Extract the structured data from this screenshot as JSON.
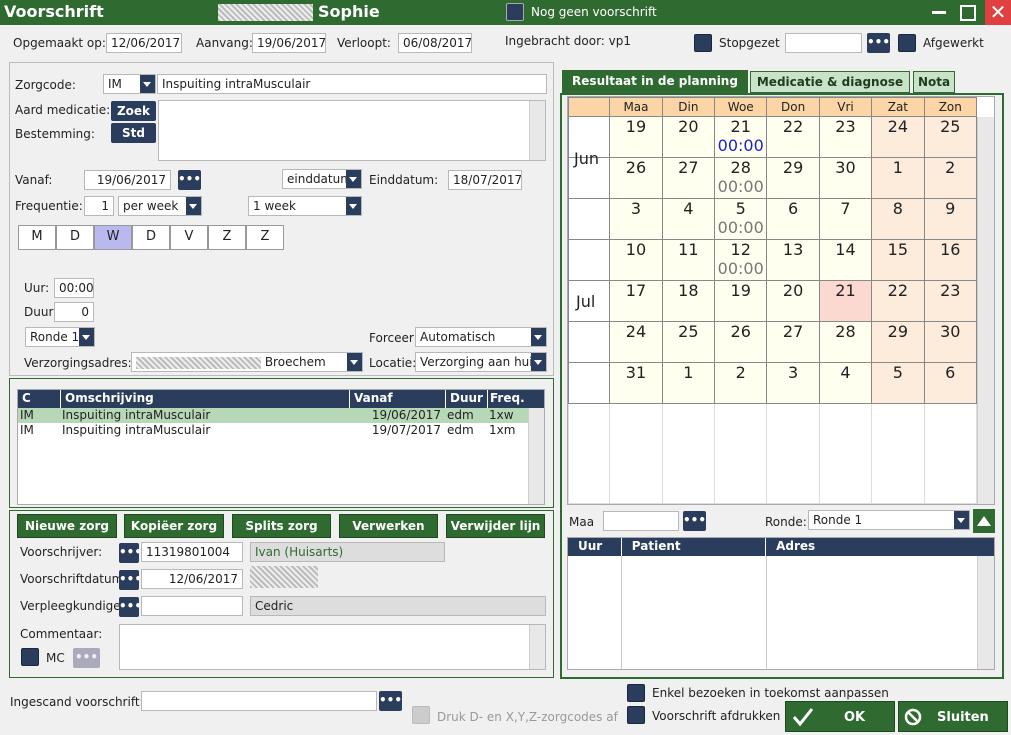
{
  "window": {
    "title": "Voorschrift",
    "patient_name": "Sophie",
    "no_prescription_label": "Nog geen voorschrift"
  },
  "header": {
    "made_on_label": "Opgemaakt op:",
    "made_on": "12/06/2017",
    "start_label": "Aanvang:",
    "start": "19/06/2017",
    "expires_label": "Verloopt:",
    "expires": "06/08/2017",
    "entered_by": "Ingebracht door: vp1",
    "stopped_label": "Stopgezet",
    "finished_label": "Afgewerkt"
  },
  "form": {
    "zorgcode_label": "Zorgcode:",
    "zorgcode": "IM",
    "zorgcode_desc": "Inspuiting intraMusculair",
    "aard_label": "Aard medicatie:",
    "zoek_button": "Zoek",
    "bestemming_label": "Bestemming:",
    "std_button": "Std",
    "vanaf_label": "Vanaf:",
    "vanaf": "19/06/2017",
    "einddatum_mode": "einddatum",
    "einddatum_label": "Einddatum:",
    "einddatum": "18/07/2017",
    "frequentie_label": "Frequentie:",
    "freq_count": "1",
    "freq_unit": "per week",
    "freq_period": "1 week",
    "days": [
      "M",
      "D",
      "W",
      "D",
      "V",
      "Z",
      "Z"
    ],
    "uur_label": "Uur:",
    "uur": "00:00",
    "duur_label": "Duur",
    "duur": "0",
    "ronde": "Ronde 1",
    "forceer_label": "Forceer",
    "forceer": "Automatisch",
    "adres_label": "Verzorgingsadres:",
    "adres": "Broechem",
    "locatie_label": "Locatie:",
    "locatie": "Verzorging aan huis"
  },
  "care_table": {
    "headers": [
      "C",
      "Omschrijving",
      "Vanaf",
      "Duur",
      "Freq."
    ],
    "rows": [
      [
        "IM",
        "Inspuiting intraMusculair",
        "19/06/2017",
        "edm",
        "1xw"
      ],
      [
        "IM",
        "Inspuiting intraMusculair",
        "19/07/2017",
        "edm",
        "1xm"
      ]
    ]
  },
  "actions": [
    "Nieuwe zorg",
    "Kopiëer zorg",
    "Splits zorg",
    "Verwerken",
    "Verwijder lijn"
  ],
  "prescriber": {
    "voorschrijver_label": "Voorschrijver:",
    "voorschrijver_id": "11319801004",
    "voorschrijver_name": "Ivan (Huisarts)",
    "datum_label": "Voorschriftdatum",
    "datum": "12/06/2017",
    "verpleeg_label": "Verpleegkundige:",
    "verpleeg_name": "Cedric",
    "commentaar_label": "Commentaar:",
    "mc_label": "MC"
  },
  "tabs": [
    "Resultaat in de planning",
    "Medicatie & diagnose",
    "Nota"
  ],
  "calendar": {
    "weekdays": [
      "Maa",
      "Din",
      "Woe",
      "Don",
      "Vri",
      "Zat",
      "Zon"
    ],
    "months": [
      "Jun",
      "Jul"
    ],
    "weeks": [
      [
        {
          "d": "19"
        },
        {
          "d": "20"
        },
        {
          "d": "21",
          "t": "00:00",
          "blue": true
        },
        {
          "d": "22"
        },
        {
          "d": "23"
        },
        {
          "d": "24"
        },
        {
          "d": "25"
        }
      ],
      [
        {
          "d": "26"
        },
        {
          "d": "27"
        },
        {
          "d": "28",
          "t": "00:00"
        },
        {
          "d": "29"
        },
        {
          "d": "30"
        },
        {
          "d": "1"
        },
        {
          "d": "2"
        }
      ],
      [
        {
          "d": "3"
        },
        {
          "d": "4"
        },
        {
          "d": "5",
          "t": "00:00"
        },
        {
          "d": "6"
        },
        {
          "d": "7"
        },
        {
          "d": "8"
        },
        {
          "d": "9"
        }
      ],
      [
        {
          "d": "10"
        },
        {
          "d": "11"
        },
        {
          "d": "12",
          "t": "00:00"
        },
        {
          "d": "13"
        },
        {
          "d": "14"
        },
        {
          "d": "15"
        },
        {
          "d": "16"
        }
      ],
      [
        {
          "d": "17"
        },
        {
          "d": "18"
        },
        {
          "d": "19"
        },
        {
          "d": "20"
        },
        {
          "d": "21",
          "today": true
        },
        {
          "d": "22"
        },
        {
          "d": "23"
        }
      ],
      [
        {
          "d": "24"
        },
        {
          "d": "25"
        },
        {
          "d": "26"
        },
        {
          "d": "27"
        },
        {
          "d": "28"
        },
        {
          "d": "29"
        },
        {
          "d": "30"
        }
      ],
      [
        {
          "d": "31"
        },
        {
          "d": "1"
        },
        {
          "d": "2"
        },
        {
          "d": "3"
        },
        {
          "d": "4"
        },
        {
          "d": "5"
        },
        {
          "d": "6"
        }
      ]
    ]
  },
  "planning": {
    "maa_label": "Maa",
    "ronde_label": "Ronde:",
    "ronde": "Ronde 1",
    "headers": [
      "Uur",
      "Patient",
      "Adres"
    ]
  },
  "footer": {
    "scan_label": "Ingescand voorschrift:",
    "druk_label": "Druk D- en X,Y,Z-zorgcodes af",
    "toekomst_label": "Enkel bezoeken in toekomst aanpassen",
    "afdrukken_label": "Voorschrift afdrukken",
    "ok": "OK",
    "sluiten": "Sluiten"
  },
  "colors": {
    "green": "#2f6b30",
    "navy": "#2a3d5c",
    "weekday_cell": "#fffff0",
    "weekend_cell": "#fdebdc",
    "header_orange": "#fbd5a5"
  }
}
